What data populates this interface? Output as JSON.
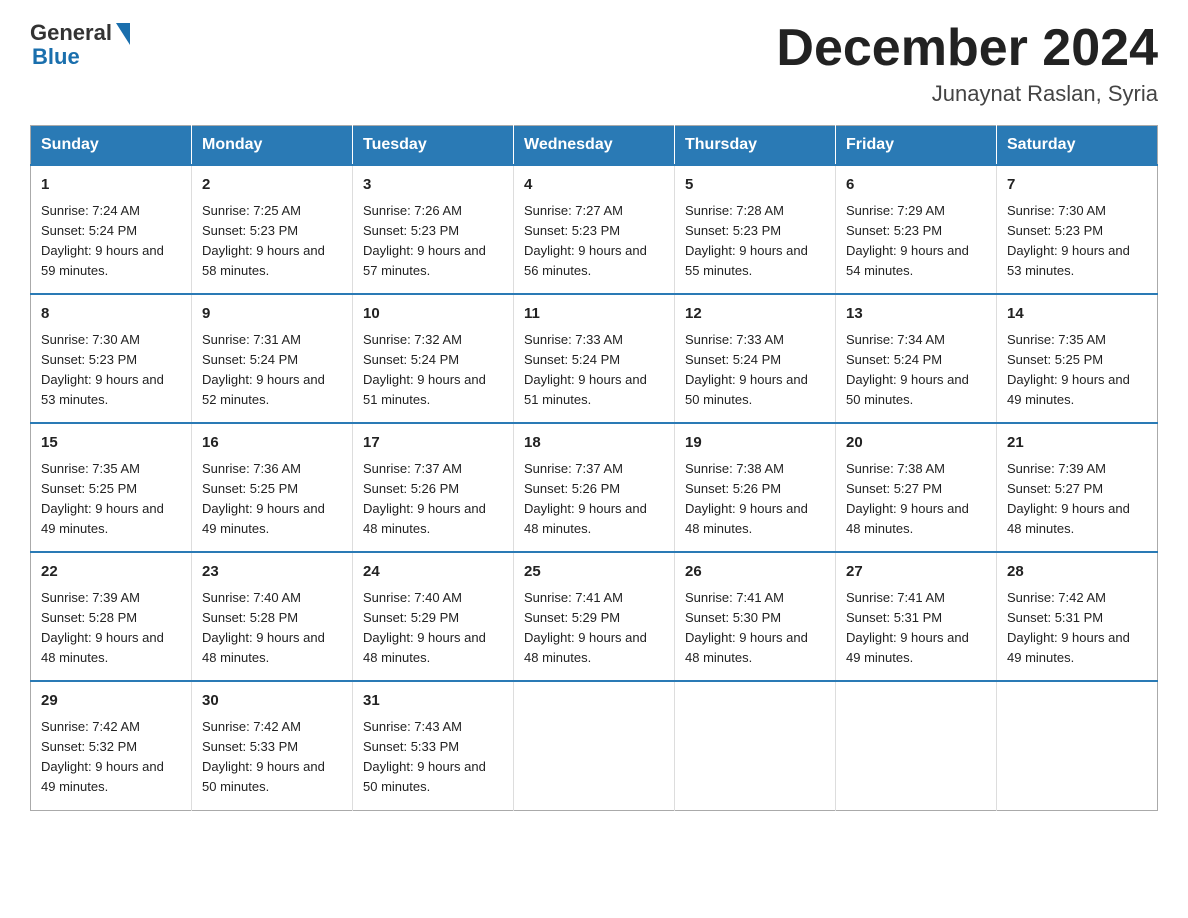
{
  "logo": {
    "general": "General",
    "blue": "Blue"
  },
  "title": "December 2024",
  "subtitle": "Junaynat Raslan, Syria",
  "days": [
    "Sunday",
    "Monday",
    "Tuesday",
    "Wednesday",
    "Thursday",
    "Friday",
    "Saturday"
  ],
  "weeks": [
    [
      {
        "num": "1",
        "sunrise": "7:24 AM",
        "sunset": "5:24 PM",
        "daylight": "9 hours and 59 minutes."
      },
      {
        "num": "2",
        "sunrise": "7:25 AM",
        "sunset": "5:23 PM",
        "daylight": "9 hours and 58 minutes."
      },
      {
        "num": "3",
        "sunrise": "7:26 AM",
        "sunset": "5:23 PM",
        "daylight": "9 hours and 57 minutes."
      },
      {
        "num": "4",
        "sunrise": "7:27 AM",
        "sunset": "5:23 PM",
        "daylight": "9 hours and 56 minutes."
      },
      {
        "num": "5",
        "sunrise": "7:28 AM",
        "sunset": "5:23 PM",
        "daylight": "9 hours and 55 minutes."
      },
      {
        "num": "6",
        "sunrise": "7:29 AM",
        "sunset": "5:23 PM",
        "daylight": "9 hours and 54 minutes."
      },
      {
        "num": "7",
        "sunrise": "7:30 AM",
        "sunset": "5:23 PM",
        "daylight": "9 hours and 53 minutes."
      }
    ],
    [
      {
        "num": "8",
        "sunrise": "7:30 AM",
        "sunset": "5:23 PM",
        "daylight": "9 hours and 53 minutes."
      },
      {
        "num": "9",
        "sunrise": "7:31 AM",
        "sunset": "5:24 PM",
        "daylight": "9 hours and 52 minutes."
      },
      {
        "num": "10",
        "sunrise": "7:32 AM",
        "sunset": "5:24 PM",
        "daylight": "9 hours and 51 minutes."
      },
      {
        "num": "11",
        "sunrise": "7:33 AM",
        "sunset": "5:24 PM",
        "daylight": "9 hours and 51 minutes."
      },
      {
        "num": "12",
        "sunrise": "7:33 AM",
        "sunset": "5:24 PM",
        "daylight": "9 hours and 50 minutes."
      },
      {
        "num": "13",
        "sunrise": "7:34 AM",
        "sunset": "5:24 PM",
        "daylight": "9 hours and 50 minutes."
      },
      {
        "num": "14",
        "sunrise": "7:35 AM",
        "sunset": "5:25 PM",
        "daylight": "9 hours and 49 minutes."
      }
    ],
    [
      {
        "num": "15",
        "sunrise": "7:35 AM",
        "sunset": "5:25 PM",
        "daylight": "9 hours and 49 minutes."
      },
      {
        "num": "16",
        "sunrise": "7:36 AM",
        "sunset": "5:25 PM",
        "daylight": "9 hours and 49 minutes."
      },
      {
        "num": "17",
        "sunrise": "7:37 AM",
        "sunset": "5:26 PM",
        "daylight": "9 hours and 48 minutes."
      },
      {
        "num": "18",
        "sunrise": "7:37 AM",
        "sunset": "5:26 PM",
        "daylight": "9 hours and 48 minutes."
      },
      {
        "num": "19",
        "sunrise": "7:38 AM",
        "sunset": "5:26 PM",
        "daylight": "9 hours and 48 minutes."
      },
      {
        "num": "20",
        "sunrise": "7:38 AM",
        "sunset": "5:27 PM",
        "daylight": "9 hours and 48 minutes."
      },
      {
        "num": "21",
        "sunrise": "7:39 AM",
        "sunset": "5:27 PM",
        "daylight": "9 hours and 48 minutes."
      }
    ],
    [
      {
        "num": "22",
        "sunrise": "7:39 AM",
        "sunset": "5:28 PM",
        "daylight": "9 hours and 48 minutes."
      },
      {
        "num": "23",
        "sunrise": "7:40 AM",
        "sunset": "5:28 PM",
        "daylight": "9 hours and 48 minutes."
      },
      {
        "num": "24",
        "sunrise": "7:40 AM",
        "sunset": "5:29 PM",
        "daylight": "9 hours and 48 minutes."
      },
      {
        "num": "25",
        "sunrise": "7:41 AM",
        "sunset": "5:29 PM",
        "daylight": "9 hours and 48 minutes."
      },
      {
        "num": "26",
        "sunrise": "7:41 AM",
        "sunset": "5:30 PM",
        "daylight": "9 hours and 48 minutes."
      },
      {
        "num": "27",
        "sunrise": "7:41 AM",
        "sunset": "5:31 PM",
        "daylight": "9 hours and 49 minutes."
      },
      {
        "num": "28",
        "sunrise": "7:42 AM",
        "sunset": "5:31 PM",
        "daylight": "9 hours and 49 minutes."
      }
    ],
    [
      {
        "num": "29",
        "sunrise": "7:42 AM",
        "sunset": "5:32 PM",
        "daylight": "9 hours and 49 minutes."
      },
      {
        "num": "30",
        "sunrise": "7:42 AM",
        "sunset": "5:33 PM",
        "daylight": "9 hours and 50 minutes."
      },
      {
        "num": "31",
        "sunrise": "7:43 AM",
        "sunset": "5:33 PM",
        "daylight": "9 hours and 50 minutes."
      },
      null,
      null,
      null,
      null
    ]
  ]
}
